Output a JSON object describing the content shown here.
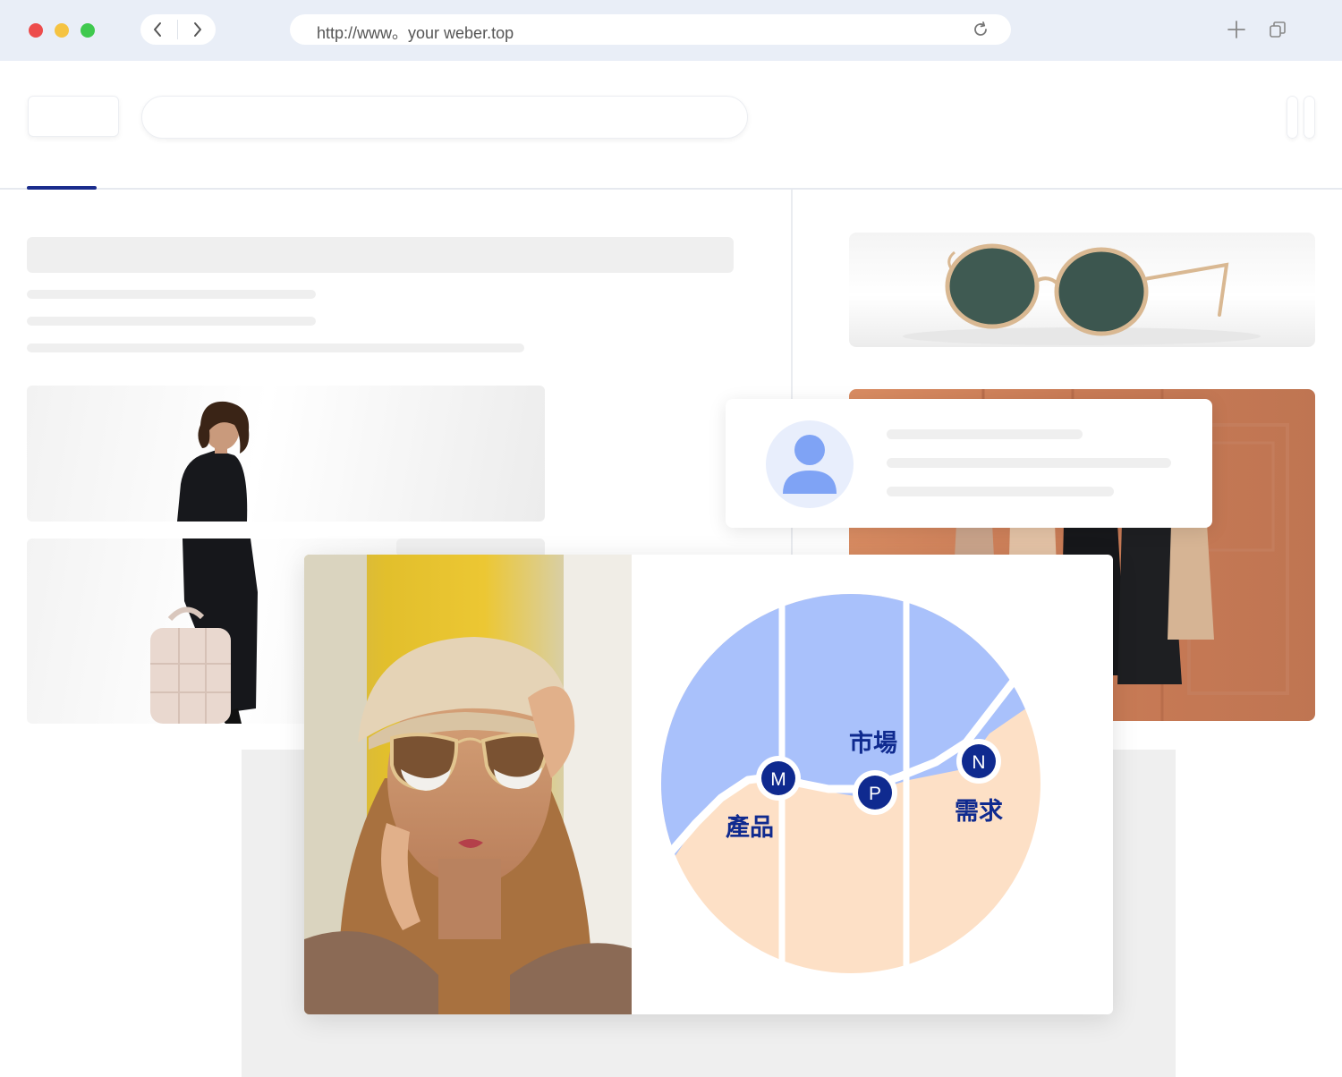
{
  "browser": {
    "url": "http://www。your weber.top",
    "traffic_lights": [
      "#ed4c4c",
      "#f5c342",
      "#3fc94e"
    ]
  },
  "diagram": {
    "labels": {
      "market": "市場",
      "product": "產品",
      "demand": "需求"
    },
    "markers": [
      "M",
      "P",
      "N"
    ]
  },
  "colors": {
    "accent": "#1a2c8c",
    "blue_region": "#a9c1fb",
    "peach_region": "#fde0c6",
    "marker": "#0f2a8f"
  }
}
